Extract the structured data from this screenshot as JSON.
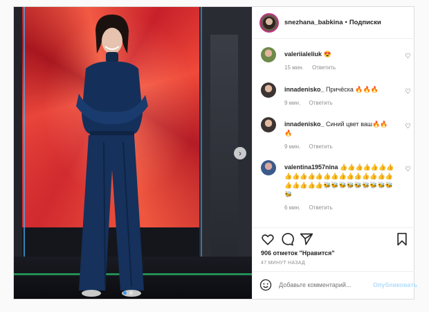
{
  "post": {
    "username": "snezhana_babkina",
    "separator": "•",
    "follow_label": "Подписки"
  },
  "comments": [
    {
      "user": "valeriialeliuk",
      "text": "😍",
      "time": "15 мин.",
      "reply": "Ответить"
    },
    {
      "user": "innadenisko_",
      "text": "Причёска 🔥🔥🔥",
      "time": "9 мин.",
      "reply": "Ответить"
    },
    {
      "user": "innadenisko_",
      "text": "Синий цвет ваш🔥🔥🔥",
      "time": "9 мин.",
      "reply": "Ответить"
    },
    {
      "user": "valentina1957nina",
      "text": "👍👍👍👍👍👍👍👍👍👍👍👍👍👍👍👍👍👍👍👍👍👍👍👍👍👍🐝🐝🐝🐝🐝🐝🐝🐝🐝🐝",
      "time": "6 мин.",
      "reply": "Ответить"
    }
  ],
  "likes_text": "906 отметок \"Нравится\"",
  "date_text": "47 МИНУТ НАЗАД",
  "add_comment": {
    "placeholder": "Добавьте комментарий...",
    "post_label": "Опубликовать"
  },
  "icons": {
    "next": "chevron-right-icon",
    "like": "heart-icon",
    "comment": "comment-icon",
    "share": "share-icon",
    "save": "bookmark-icon",
    "emoji": "smile-icon"
  },
  "colors": {
    "accent": "#3897f0",
    "post_disabled": "#b2dffc"
  }
}
